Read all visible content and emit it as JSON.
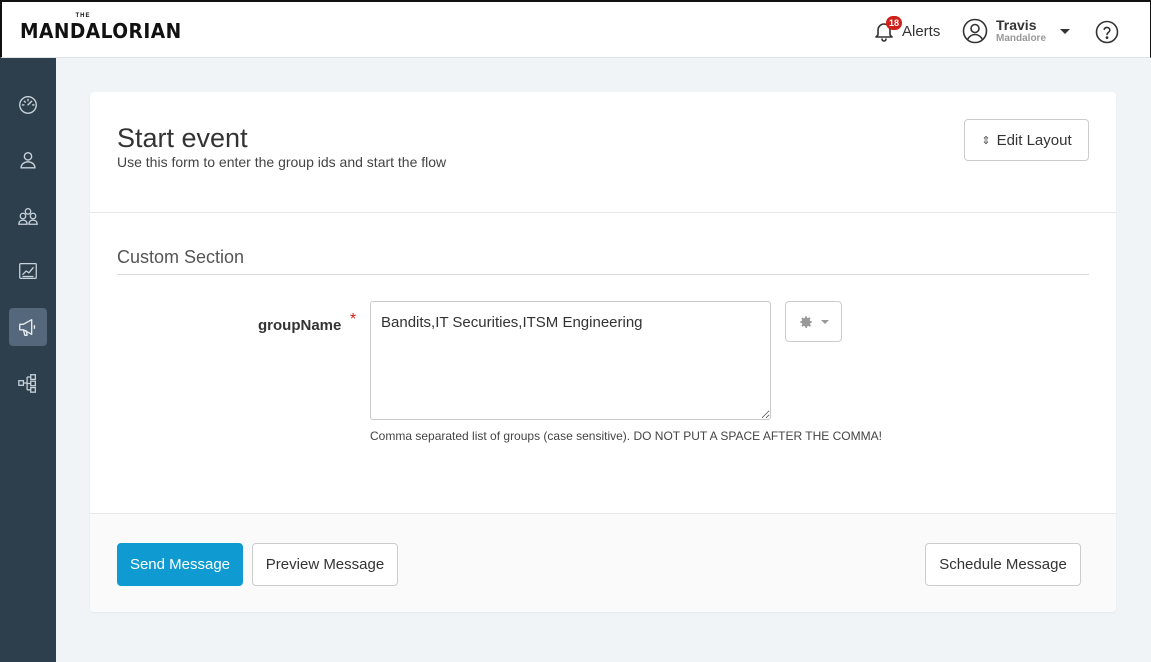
{
  "header": {
    "logo_top": "THE",
    "logo_main": "MANDALORIAN",
    "alerts_count": "18",
    "alerts_label": "Alerts",
    "user_name": "Travis",
    "user_org": "Mandalore"
  },
  "sidebar": {
    "items": [
      {
        "icon": "dashboard-icon",
        "active": false
      },
      {
        "icon": "user-icon",
        "active": false
      },
      {
        "icon": "groups-icon",
        "active": false
      },
      {
        "icon": "reports-icon",
        "active": false
      },
      {
        "icon": "megaphone-icon",
        "active": true
      },
      {
        "icon": "flow-icon",
        "active": false
      }
    ]
  },
  "form": {
    "title": "Start event",
    "subtitle": "Use this form to enter the group ids and start the flow",
    "edit_layout_label": "Edit Layout",
    "section_title": "Custom Section",
    "field_label": "groupName",
    "required_mark": "*",
    "field_value": "Bandits,IT Securities,ITSM Engineering",
    "field_help": "Comma separated list of groups (case sensitive). DO NOT PUT A SPACE AFTER THE COMMA!"
  },
  "footer": {
    "send_label": "Send Message",
    "preview_label": "Preview Message",
    "schedule_label": "Schedule Message"
  },
  "colors": {
    "primary": "#0f9bd1",
    "sidebar": "#2d3e4c",
    "badge": "#d0201a"
  }
}
